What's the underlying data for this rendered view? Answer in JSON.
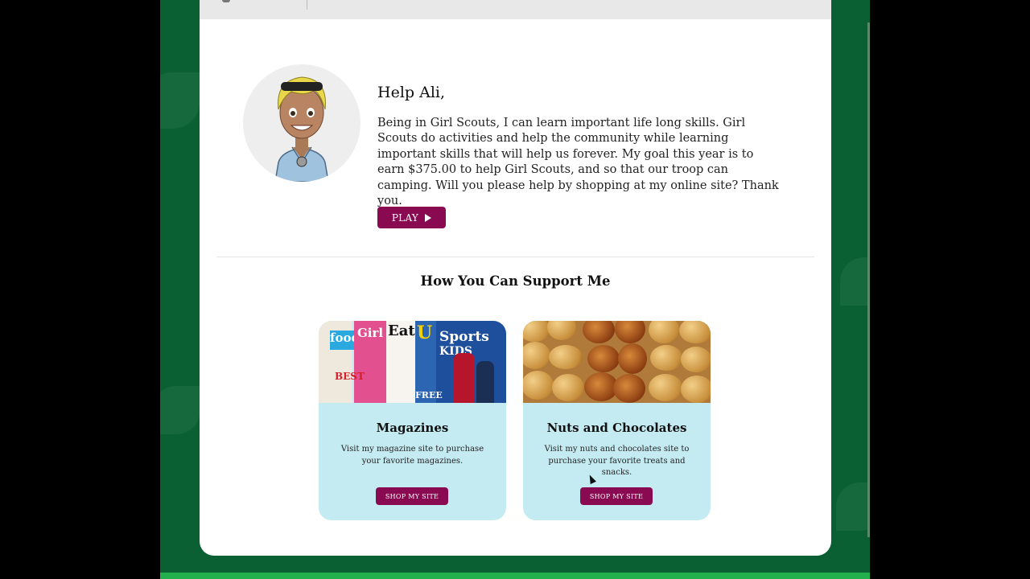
{
  "profile": {
    "greeting": "Help Ali,",
    "message": "Being in Girl Scouts, I can learn important life long skills. Girl Scouts do activities and help the community while learning important skills that will help us forever. My goal this year is to earn $375.00 to help Girl Scouts, and so that our troop can camping. Will you please help by shopping at my online site? Thank you.",
    "play_label": "PLAY"
  },
  "support": {
    "title": "How You Can Support Me",
    "options": [
      {
        "title": "Magazines",
        "description": "Visit my magazine site to purchase your favorite magazines.",
        "button_label": "SHOP MY SITE"
      },
      {
        "title": "Nuts and Chocolates",
        "description": "Visit my nuts and chocolates site to purchase your favorite treats and snacks.",
        "button_label": "SHOP MY SITE"
      }
    ]
  },
  "magazine_covers": [
    "food",
    "Girl",
    "Eati",
    "U",
    "Sports",
    "KIDS",
    "BEST",
    "FREE"
  ],
  "colors": {
    "page_background": "#0a6033",
    "accent": "#8a0a52",
    "option_card": "#c4ebf2",
    "bottom_stripe": "#21b04b"
  }
}
